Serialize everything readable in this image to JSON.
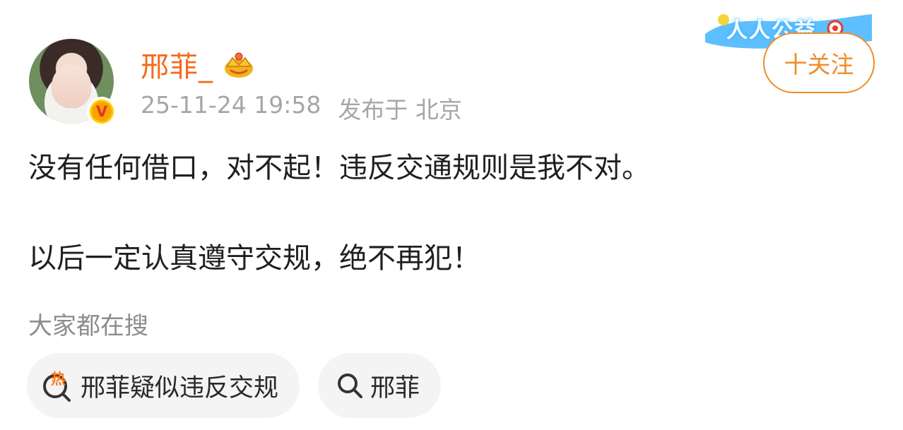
{
  "header": {
    "username": "邢菲_",
    "timestamp": "25-11-24 19:58",
    "location": "发布于 北京",
    "badge_letter": "V",
    "banner_text": "人人公益",
    "follow_label": "十关注"
  },
  "post": {
    "line1": "没有任何借口，对不起！违反交通规则是我不对。",
    "line2": "以后一定认真遵守交规，绝不再犯！"
  },
  "search": {
    "heading": "大家都在搜",
    "chips": [
      {
        "label": "邢菲疑似违反交规",
        "icon": "hot-search-icon",
        "icon_text": "热"
      },
      {
        "label": "邢菲",
        "icon": "search-icon"
      }
    ]
  },
  "colors": {
    "accent": "#f36b1c",
    "follow_border": "#f08c2a",
    "muted": "#a6a6a6"
  }
}
